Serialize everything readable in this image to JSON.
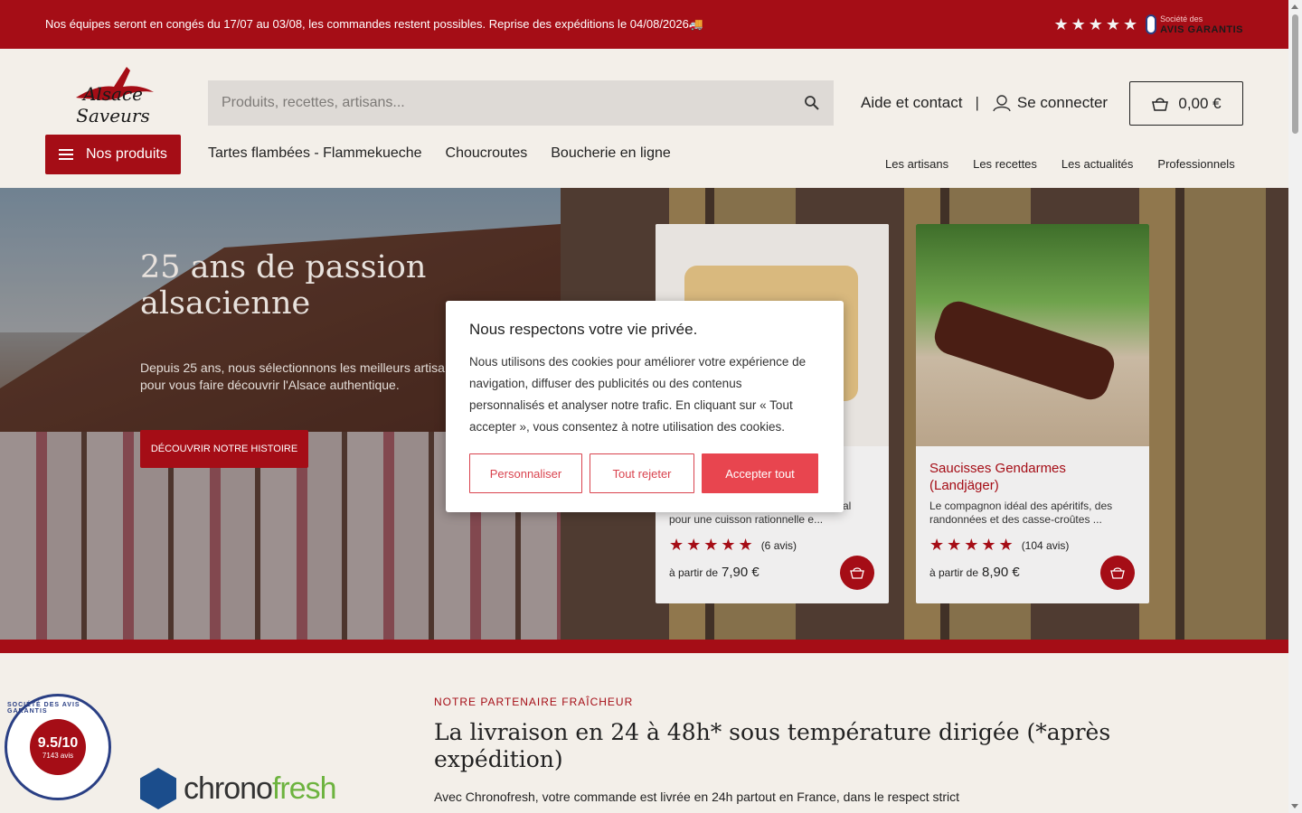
{
  "topbar": {
    "announcement": "Nos équipes seront en congés du 17/07 au 03/08, les commandes restent possibles. Reprise des expéditions le 04/08/2026🚚",
    "stars": "★★★★★",
    "reviews_brand_small": "Société des",
    "reviews_brand": "AVIS GARANTIS"
  },
  "header": {
    "logo_text": "Alsace Saveurs",
    "search_placeholder": "Produits, recettes, artisans...",
    "help_label": "Aide et contact",
    "separator": "|",
    "login_label": "Se connecter",
    "cart_total": "0,00 €",
    "products_button": "Nos produits",
    "main_nav": [
      "Tartes flambées - Flammekueche",
      "Choucroutes",
      "Boucherie en ligne"
    ],
    "secondary_nav": [
      "Les artisans",
      "Les recettes",
      "Les actualités",
      "Professionnels"
    ]
  },
  "hero": {
    "title": "25 ans de passion alsacienne",
    "text": "Depuis 25 ans, nous sélectionnons les meilleurs artisans pour vous faire découvrir l'Alsace authentique.",
    "cta": "DÉCOUVRIR NOTRE HISTOIRE"
  },
  "cards": [
    {
      "title": "",
      "desc": "pour une cuisson rationnelle e...",
      "desc_partial": "al",
      "stars": "★★★★★",
      "reviews": "(6 avis)",
      "price_prefix": "à partir de",
      "price": "7,90 €"
    },
    {
      "title": "Saucisses Gendarmes (Landjäger)",
      "desc": "Le compagnon idéal des apéritifs, des randonnées et des casse-croûtes ...",
      "stars": "★★★★★",
      "reviews": "(104 avis)",
      "price_prefix": "à partir de",
      "price": "8,90 €"
    }
  ],
  "badge": {
    "ring": "SOCIÉTÉ DES AVIS GARANTIS",
    "score": "9.5/10",
    "count": "7143 avis"
  },
  "partner": {
    "logo_main": "chrono",
    "logo_accent": "fresh",
    "kicker": "NOTRE PARTENAIRE FRAÎCHEUR",
    "title": "La livraison en 24 à 48h* sous température dirigée (*après expédition)",
    "text": "Avec Chronofresh, votre commande est livrée en 24h partout en France, dans le respect strict"
  },
  "cookie": {
    "title": "Nous respectons votre vie privée.",
    "text": "Nous utilisons des cookies pour améliorer votre expérience de navigation, diffuser des publicités ou des contenus personnalisés et analyser notre trafic. En cliquant sur « Tout accepter », vous consentez à notre utilisation des cookies.",
    "customize": "Personnaliser",
    "reject": "Tout rejeter",
    "accept": "Accepter tout"
  },
  "colors": {
    "brand_red": "#a50d16",
    "cookie_red": "#e8454f",
    "background": "#f3efe9"
  }
}
